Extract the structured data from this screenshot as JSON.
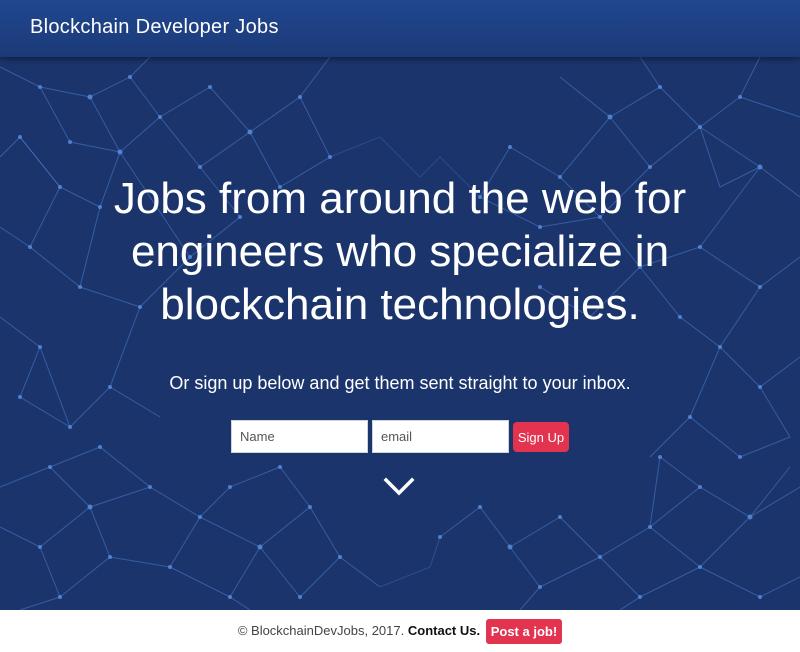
{
  "navbar": {
    "brand": "Blockchain Developer Jobs"
  },
  "hero": {
    "headline": "Jobs from around the web for engineers who specialize in blockchain technologies.",
    "subline": "Or sign up below and get them sent straight to your inbox.",
    "form": {
      "name_placeholder": "Name",
      "email_placeholder": "email",
      "signup_label": "Sign Up"
    },
    "scroll_icon": "chevron-down-icon"
  },
  "footer": {
    "copyright": "© BlockchainDevJobs, 2017.",
    "contact_label": "Contact Us.",
    "post_job_label": "Post a job!"
  },
  "colors": {
    "navbar": "#1f4386",
    "hero_background": "#1b356c",
    "network_lines": "#4a7ed0",
    "accent": "#e2334f"
  }
}
